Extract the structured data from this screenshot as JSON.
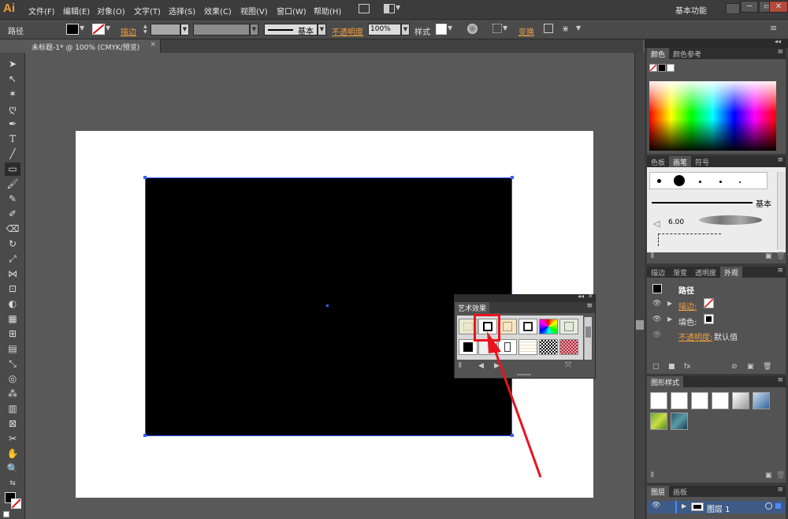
{
  "app": {
    "logo": "Ai"
  },
  "menubar": {
    "items": [
      "文件(F)",
      "编辑(E)",
      "对象(O)",
      "文字(T)",
      "选择(S)",
      "效果(C)",
      "视图(V)",
      "窗口(W)",
      "帮助(H)"
    ],
    "workspace": "基本功能"
  },
  "control": {
    "object_type": "路径",
    "stroke_label": "描边",
    "stroke_style": "基本",
    "opacity_label": "不透明度",
    "opacity_value": "100%",
    "style_label": "样式",
    "transform_label": "变换"
  },
  "document": {
    "tab_title": "未标题-1* @ 100% (CMYK/预览)"
  },
  "panels": {
    "color": {
      "tabs": [
        "颜色",
        "颜色参考"
      ]
    },
    "brushes": {
      "tabs": [
        "色板",
        "画笔",
        "符号"
      ],
      "stroke_style": "基本",
      "size_value": "6.00"
    },
    "appearance": {
      "tabs": [
        "描边",
        "渐变",
        "透明度",
        "外观"
      ],
      "title": "路径",
      "rows": [
        {
          "label": "描边:"
        },
        {
          "label": "填色:"
        },
        {
          "label": "不透明度:",
          "value": "默认值"
        }
      ]
    },
    "graphic_styles": {
      "tabs": [
        "图形样式"
      ]
    },
    "layers": {
      "tabs": [
        "图层",
        "画板"
      ],
      "layer_name": "图层 1"
    }
  },
  "art_effect_panel": {
    "title": "艺术效果"
  },
  "colors": {
    "accent_orange": "#f0a040",
    "annotation_red": "#e8141e",
    "selection_blue": "#3a5cff"
  }
}
